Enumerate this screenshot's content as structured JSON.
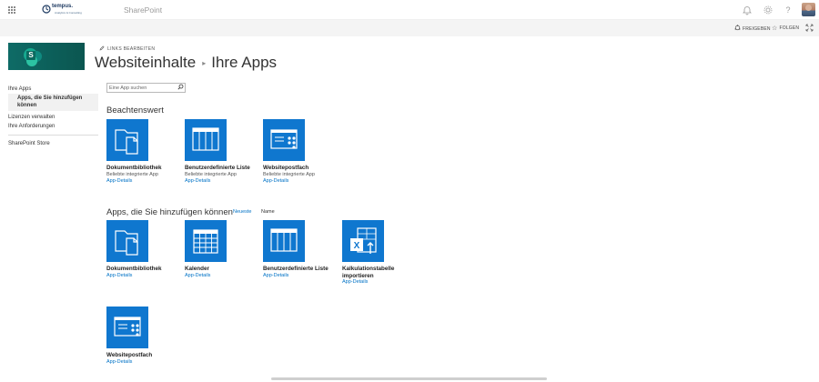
{
  "suite": {
    "app_name": "SharePoint",
    "logo_text": "tempus.",
    "logo_sub": "Analytics & Consulting"
  },
  "actions": {
    "share": "FREIGEBEN",
    "follow": "FOLGEN"
  },
  "header": {
    "edit_links": "LINKS BEARBEITEN",
    "title_part1": "Websiteinhalte",
    "title_part2": "Ihre Apps",
    "site_logo_letter": "S"
  },
  "leftnav": {
    "items": [
      {
        "label": "Ihre Apps"
      },
      {
        "label": "Apps, die Sie hinzufügen können"
      },
      {
        "label": "Lizenzen verwalten"
      },
      {
        "label": "Ihre Anforderungen"
      },
      {
        "label": "SharePoint Store"
      }
    ]
  },
  "search": {
    "placeholder": "Eine App suchen"
  },
  "noteworthy": {
    "heading": "Beachtenswert",
    "tiles": [
      {
        "title": "Dokumentbibliothek",
        "desc": "Beliebte integrierte App",
        "link": "App-Details",
        "icon": "document-library-icon"
      },
      {
        "title": "Benutzerdefinierte Liste",
        "desc": "Beliebte integrierte App",
        "link": "App-Details",
        "icon": "custom-list-icon"
      },
      {
        "title": "Websitepostfach",
        "desc": "Beliebte integrierte App",
        "link": "App-Details",
        "icon": "site-mailbox-icon"
      }
    ]
  },
  "addable": {
    "heading": "Apps, die Sie hinzufügen können",
    "sort_newest": "Neueste",
    "sort_name": "Name",
    "tiles": [
      {
        "title": "Dokumentbibliothek",
        "link": "App-Details",
        "icon": "document-library-icon"
      },
      {
        "title": "Kalender",
        "link": "App-Details",
        "icon": "calendar-icon"
      },
      {
        "title": "Benutzerdefinierte Liste",
        "link": "App-Details",
        "icon": "custom-list-icon"
      },
      {
        "title": "Kalkulationstabelle importieren",
        "link": "App-Details",
        "icon": "import-spreadsheet-icon"
      },
      {
        "title": "Websitepostfach",
        "link": "App-Details",
        "icon": "site-mailbox-icon"
      }
    ]
  },
  "colors": {
    "tile_blue": "#0f77cf",
    "link_blue": "#0072c6",
    "site_logo": "#0e6b66"
  }
}
